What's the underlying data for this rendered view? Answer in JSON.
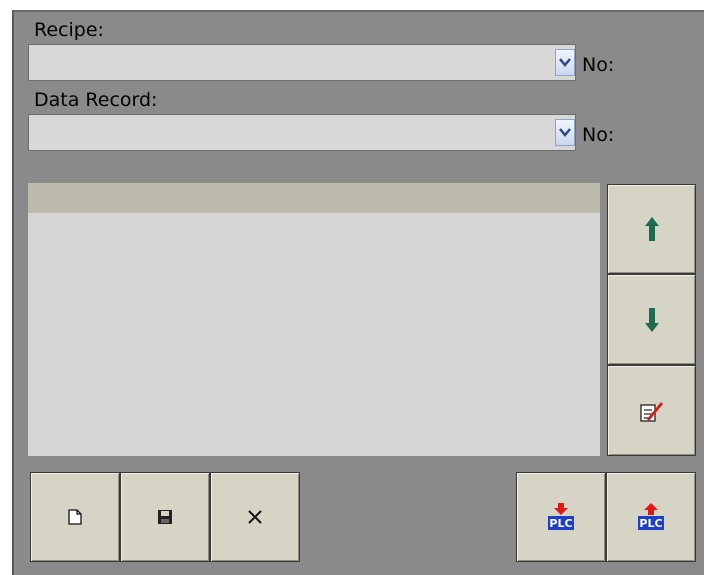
{
  "recipe": {
    "label": "Recipe:",
    "value": "",
    "no_label": "No:"
  },
  "data_record": {
    "label": "Data Record:",
    "value": "",
    "no_label": "No:"
  },
  "list": {
    "rows": []
  },
  "buttons": {
    "move_up": {
      "icon": "arrow-up-icon",
      "color": "#1f6b52"
    },
    "move_down": {
      "icon": "arrow-down-icon",
      "color": "#1f6b52"
    },
    "edit": {
      "icon": "edit-icon"
    },
    "new": {
      "icon": "new-document-icon"
    },
    "save": {
      "icon": "save-icon"
    },
    "delete": {
      "icon": "delete-icon"
    },
    "plc_download": {
      "icon": "plc-download-icon",
      "text": "PLC"
    },
    "plc_upload": {
      "icon": "plc-upload-icon",
      "text": "PLC"
    }
  },
  "colors": {
    "panel": "#8a8a8a",
    "button": "#d6d4c4",
    "plc_badge": "#1e3fc8",
    "plc_arrow": "#e01818"
  }
}
